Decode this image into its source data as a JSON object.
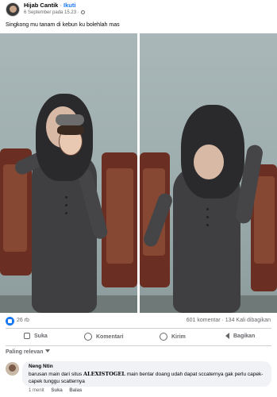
{
  "post": {
    "author": "Hijab Cantik",
    "follow_label": "Ikuti",
    "separator": "·",
    "timestamp": "6 September pada 15.23 ·",
    "caption": "Singkong mu tanam di kebun ku bolehlah mas"
  },
  "stats": {
    "likes": "26 rb",
    "comments_shares": "601 komentar · 134 Kali dibagikan"
  },
  "actions": {
    "like": "Suka",
    "comment": "Komentari",
    "send": "Kirim",
    "share": "Bagikan"
  },
  "comments": {
    "sort_label": "Paling relevan",
    "items": [
      {
        "author": "Neng Ntin",
        "text_before": "barusan main dari situs ",
        "brand": "ALEXISTOGEL",
        "text_after": " main bentar doang udah dapat sccaternya gak perlu capek-capek tunggu scatternya",
        "time": "1 menit",
        "like_label": "Suka",
        "reply_label": "Balas"
      }
    ]
  },
  "colors": {
    "accent": "#1877f2",
    "muted": "#65676b",
    "bubble": "#f0f2f5"
  }
}
